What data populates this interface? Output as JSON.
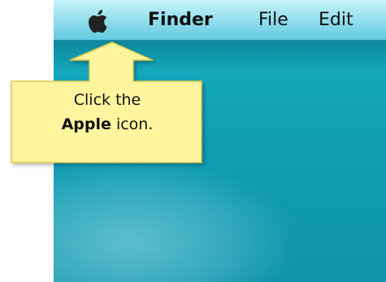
{
  "menubar": {
    "apple_icon": "apple-icon",
    "items": [
      {
        "label": "Finder"
      },
      {
        "label": "File"
      },
      {
        "label": "Edit"
      }
    ]
  },
  "callout": {
    "line1": "Click the",
    "line2_bold": "Apple",
    "line2_rest": " icon.",
    "background_color": "#fff59e",
    "border_color": "#d9c64a"
  },
  "desktop": {
    "background_color": "#139fb6"
  }
}
